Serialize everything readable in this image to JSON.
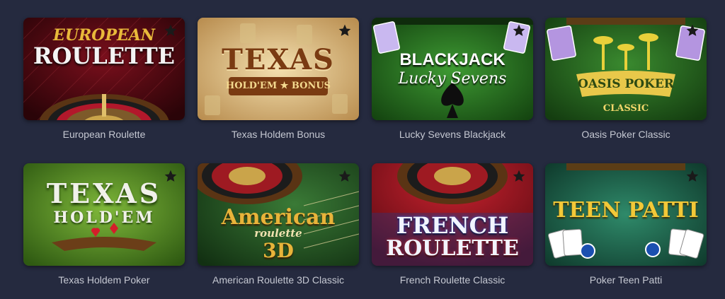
{
  "games": [
    {
      "title": "European Roulette",
      "art": [
        "EUROPEAN",
        "ROULETTE"
      ],
      "favorite_icon": "star-icon"
    },
    {
      "title": "Texas Holdem Bonus",
      "art": [
        "TEXAS",
        "HOLD'EM ★ BONUS"
      ],
      "favorite_icon": "star-icon"
    },
    {
      "title": "Lucky Sevens Blackjack",
      "art": [
        "BLACKJACK",
        "Lucky Sevens"
      ],
      "favorite_icon": "star-icon"
    },
    {
      "title": "Oasis Poker Classic",
      "art": [
        "OASIS POKER",
        "CLASSIC"
      ],
      "favorite_icon": "star-icon"
    },
    {
      "title": "Texas Holdem Poker",
      "art": [
        "TEXAS",
        "HOLD'EM"
      ],
      "favorite_icon": "star-icon"
    },
    {
      "title": "American Roulette 3D Classic",
      "art": [
        "American",
        "roulette",
        "3D"
      ],
      "favorite_icon": "star-icon"
    },
    {
      "title": "French Roulette Classic",
      "art": [
        "FRENCH",
        "ROULETTE"
      ],
      "favorite_icon": "star-icon"
    },
    {
      "title": "Poker Teen Patti",
      "art": [
        "TEEN PATTI"
      ],
      "favorite_icon": "star-icon"
    }
  ],
  "colors": {
    "background": "#252a3f",
    "caption": "#c5c8d2",
    "star": "#1a1a1a"
  }
}
